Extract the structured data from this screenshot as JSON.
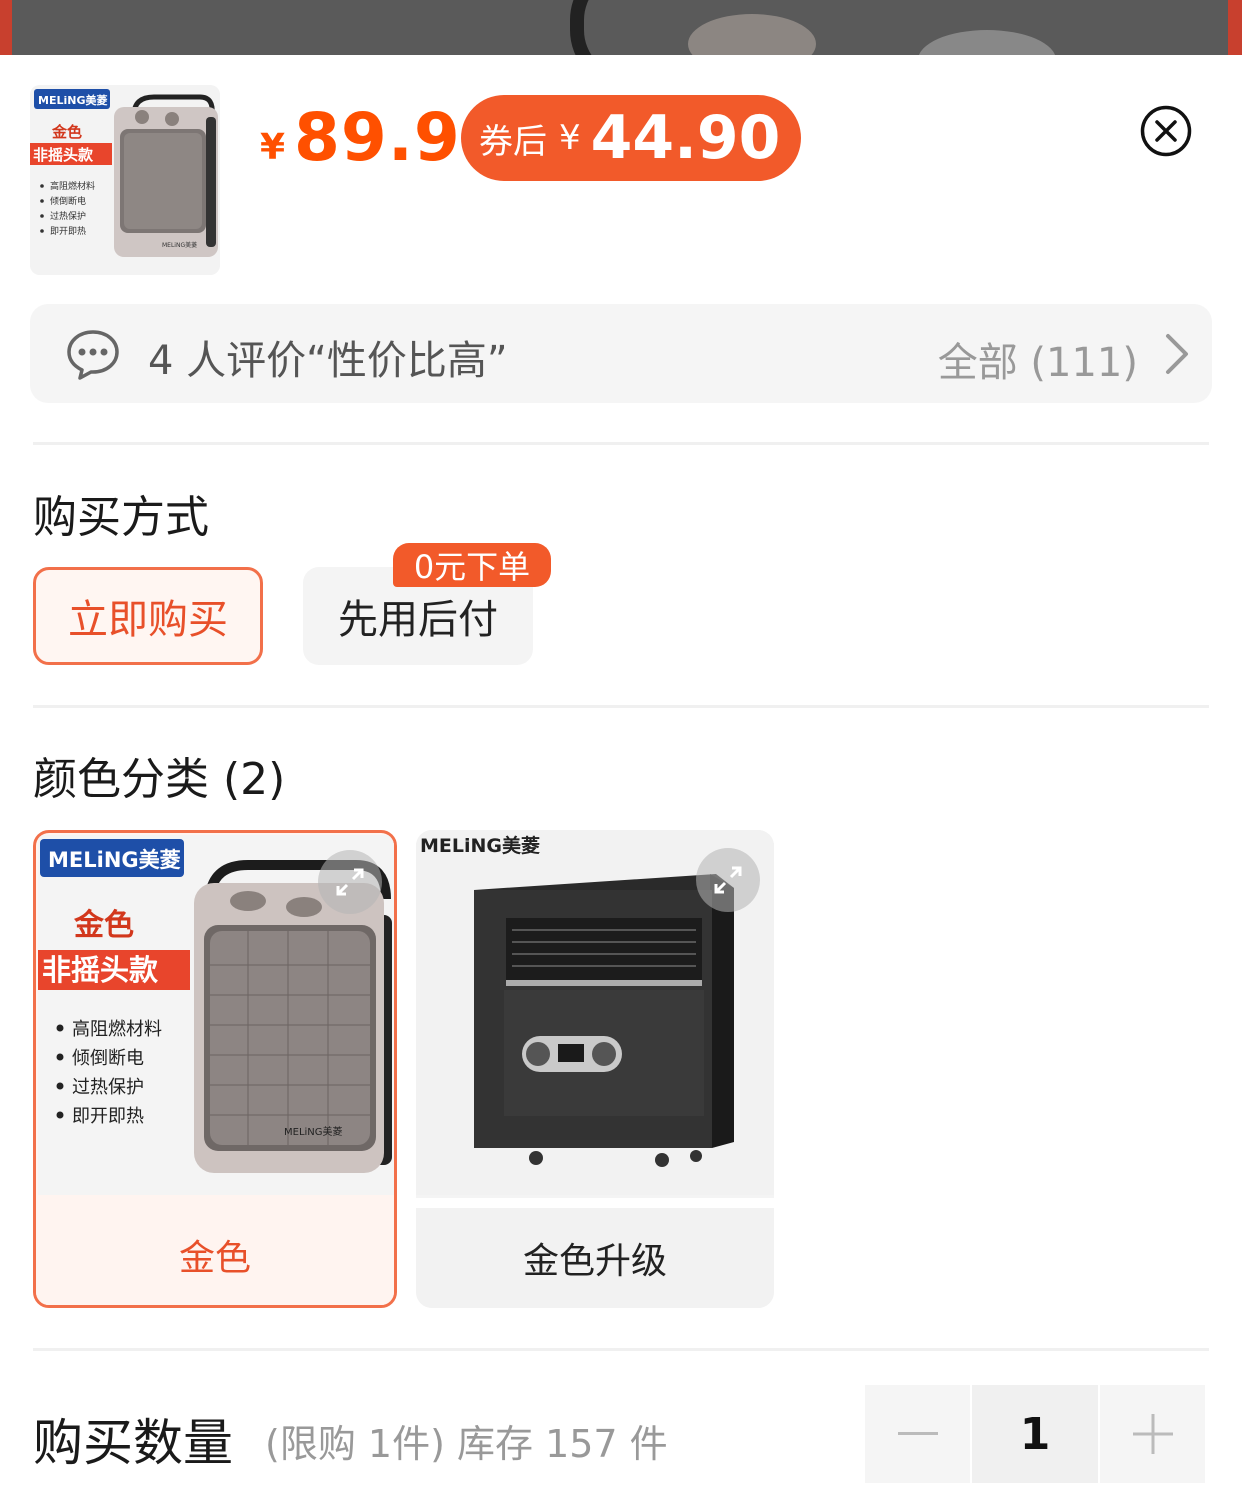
{
  "header": {
    "thumbnail": {
      "brand": "MELiNG美菱",
      "color_label": "金色",
      "model_label": "非摇头款",
      "features": [
        "高阻燃材料",
        "倾倒断电",
        "过热保护",
        "即开即热"
      ],
      "device_brand": "MELiNG美菱"
    },
    "price_symbol": "¥",
    "price": "89.9",
    "coupon_label": "券后",
    "coupon_symbol": "¥",
    "coupon_price": "44.90"
  },
  "review": {
    "summary": "4 人评价“性价比高”",
    "all_label": "全部 (111)"
  },
  "purchase_method": {
    "title": "购买方式",
    "options": [
      {
        "label": "立即购买",
        "selected": true
      },
      {
        "label": "先用后付",
        "selected": false,
        "badge": "0元下单"
      }
    ]
  },
  "color_category": {
    "title": "颜色分类 (2)",
    "options": [
      {
        "label": "金色",
        "selected": true,
        "image": {
          "brand": "MELiNG美菱",
          "color_label": "金色",
          "model_label": "非摇头款",
          "features": [
            "高阻燃材料",
            "倾倒断电",
            "过热保护",
            "即开即热"
          ],
          "device_brand": "MELiNG美菱"
        }
      },
      {
        "label": "金色升级",
        "selected": false,
        "image": {
          "brand": "MELiNG美菱"
        }
      }
    ]
  },
  "quantity": {
    "title": "购买数量",
    "note": "(限购 1件) 库存 157 件",
    "value": "1"
  },
  "colors": {
    "accent": "#ff5000",
    "coupon_bg": "#f25a2a",
    "selected_border": "#f2704a"
  }
}
